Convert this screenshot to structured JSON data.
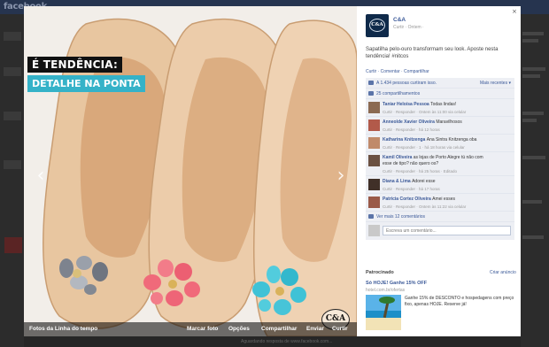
{
  "background": {
    "logo": "facebook",
    "footer_text": "Aguardando resposta de www.facebook.com..."
  },
  "photo": {
    "overlay_title": "É TENDÊNCIA:",
    "overlay_subtitle": "DETALHE NA PONTA",
    "prev_arrow": "‹",
    "next_arrow": "›",
    "logo_text": "C&A",
    "album_label": "Fotos da Linha do tempo",
    "actions": [
      "Marcar foto",
      "Opções",
      "Compartilhar",
      "Enviar",
      "Curtir"
    ],
    "shoe_color": "#e9c9a3",
    "accent_colors": {
      "jewel_gray": "#8a8f9a",
      "jewel_coral": "#f06a7a",
      "jewel_turquoise": "#3fc2d6"
    }
  },
  "panel": {
    "close": "×",
    "owner_name": "C&A",
    "owner_meta": "Curtir · Ontem ·",
    "avatar_text": "C&A",
    "caption": "Sapatilha pelo-ouro transformam seu look. Aposte nesta tendência! #nitcos",
    "post_links": "Curtir · Comentar · Compartilhar",
    "likes_text": "A 1.434 pessoas curtiram isso.",
    "likes_right": "Mais recentes ▾",
    "shares_text": "25 compartilhamentos",
    "comments": [
      {
        "name": "Taniar Heloísa Pessoa",
        "body": "Todas lindas!",
        "meta": "Curtir · Responder · Ontem às 11:00 via celular"
      },
      {
        "name": "Anneolde Xavier Oliveira",
        "body": "Maravilhosos",
        "meta": "Curtir · Responder · há 12 horas"
      },
      {
        "name": "Katharina Knitzenga",
        "body": "Ana Sintra Knitzenga oba",
        "meta": "Curtir · Responder · 1 · há 18 horas via celular"
      },
      {
        "name": "Kamil Oliveira",
        "body": "as lojas de Porto Alegre tú não com",
        "body2": "esse de tipo? não quero os?",
        "meta": "Curtir · Responder · há 25 horas · Editado"
      },
      {
        "name": "Diana & Lima",
        "body": "Adorei esse",
        "meta": "Curtir · Responder · há 17 horas"
      },
      {
        "name": "Patricia Cortez Oliveira",
        "body": "Amei esses",
        "meta": "Curtir · Responder · Ontem às 11:22 via celular"
      }
    ],
    "view_more": "Ver mais 12 comentários",
    "write_placeholder": "Escreva um comentário...",
    "sponsored_header": "Patrocinado",
    "create_ad": "Criar anúncio",
    "ad_title": "Só HOJE! Ganhe 15% OFF",
    "ad_url": "hotel.com.br/ofertas",
    "ad_text": "Ganhe 15% de DESCONTO e hospedagens com preço fixo, apenas HOJE. Reserve já!"
  }
}
